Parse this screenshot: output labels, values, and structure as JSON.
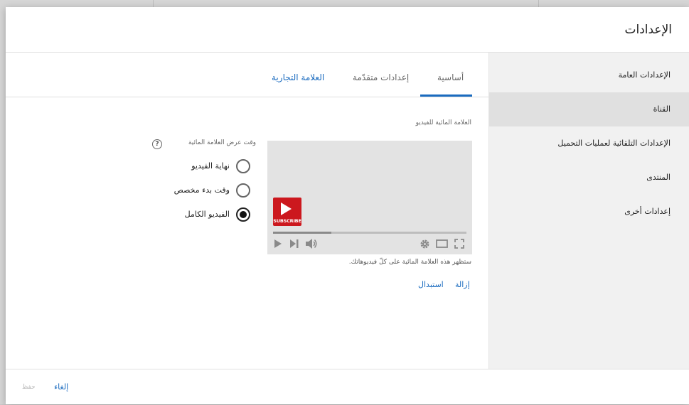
{
  "dialog": {
    "title": "الإعدادات"
  },
  "sidebar": {
    "items": [
      {
        "label": "الإعدادات العامة",
        "active": false
      },
      {
        "label": "القناة",
        "active": true
      },
      {
        "label": "الإعدادات التلقائية لعمليات التحميل",
        "active": false
      },
      {
        "label": "المنتدى",
        "active": false
      },
      {
        "label": "إعدادات أخرى",
        "active": false
      }
    ]
  },
  "tabs": [
    {
      "label": "أساسية",
      "selected": true
    },
    {
      "label": "إعدادات متقدّمة",
      "selected": false
    },
    {
      "label": "العلامة التجارية",
      "selected": false
    }
  ],
  "watermark": {
    "section_label": "العلامة المائية للفيديو",
    "logo_text": "SUBSCRIBE",
    "note": "ستظهر هذه العلامة المائية على كلّ فيديوهاتك.",
    "remove_label": "إزالة",
    "replace_label": "استبدال"
  },
  "display_time": {
    "question": "وقت عرض العلامة المائية",
    "help_icon": "?",
    "options": [
      {
        "label": "نهاية الفيديو",
        "checked": false
      },
      {
        "label": "وقت بدء مخصص",
        "checked": false
      },
      {
        "label": "الفيديو الكامل",
        "checked": true
      }
    ]
  },
  "footer": {
    "cancel_label": "إلغاء",
    "save_label": "حفظ"
  },
  "colors": {
    "accent": "#1a6bbf",
    "brand_red": "#cc181e"
  }
}
